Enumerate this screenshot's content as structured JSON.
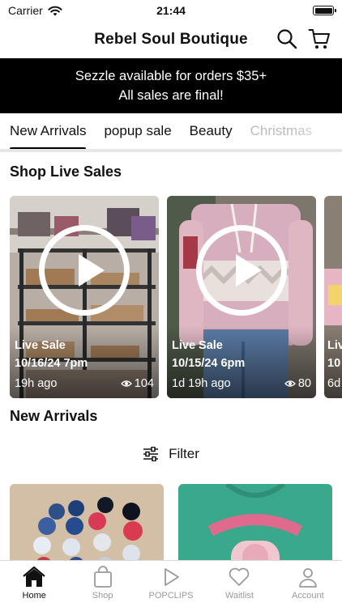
{
  "status": {
    "carrier": "Carrier",
    "time": "21:44"
  },
  "header": {
    "title": "Rebel Soul Boutique"
  },
  "banner": {
    "line1": "Sezzle available for orders $35+",
    "line2": "All sales are final!"
  },
  "tabs": [
    {
      "label": "New Arrivals",
      "active": true
    },
    {
      "label": "popup sale"
    },
    {
      "label": "Beauty"
    },
    {
      "label": "Christmas"
    }
  ],
  "live_section": {
    "title": "Shop Live Sales",
    "cards": [
      {
        "line1": "Live Sale",
        "line2": "10/16/24 7pm",
        "ago": "19h ago",
        "views": "104"
      },
      {
        "line1": "Live Sale",
        "line2": "10/15/24 6pm",
        "ago": "1d 19h ago",
        "views": "80"
      },
      {
        "line1": "Liv",
        "line2": "10",
        "ago": "6d"
      }
    ]
  },
  "new_section": {
    "title": "New Arrivals",
    "filter_label": "Filter"
  },
  "tabbar": [
    {
      "label": "Home",
      "icon": "home-icon",
      "active": true
    },
    {
      "label": "Shop",
      "icon": "bag-icon"
    },
    {
      "label": "POPCLIPS",
      "icon": "play-icon"
    },
    {
      "label": "Waitlist",
      "icon": "heart-icon"
    },
    {
      "label": "Account",
      "icon": "person-icon"
    }
  ]
}
